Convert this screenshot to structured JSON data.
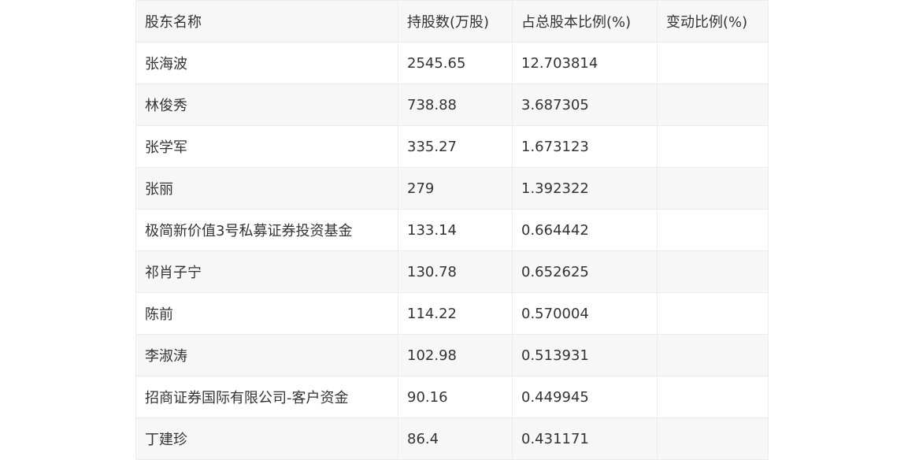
{
  "table": {
    "headers": [
      "股东名称",
      "持股数(万股)",
      "占总股本比例(%)",
      "变动比例(%)"
    ],
    "rows": [
      [
        "张海波",
        "2545.65",
        "12.703814",
        ""
      ],
      [
        "林俊秀",
        "738.88",
        "3.687305",
        ""
      ],
      [
        "张学军",
        "335.27",
        "1.673123",
        ""
      ],
      [
        "张丽",
        "279",
        "1.392322",
        ""
      ],
      [
        "极简新价值3号私募证券投资基金",
        "133.14",
        "0.664442",
        ""
      ],
      [
        "祁肖子宁",
        "130.78",
        "0.652625",
        ""
      ],
      [
        "陈前",
        "114.22",
        "0.570004",
        ""
      ],
      [
        "李淑涛",
        "102.98",
        "0.513931",
        ""
      ],
      [
        "招商证券国际有限公司-客户资金",
        "90.16",
        "0.449945",
        ""
      ],
      [
        "丁建珍",
        "86.4",
        "0.431171",
        ""
      ]
    ]
  }
}
